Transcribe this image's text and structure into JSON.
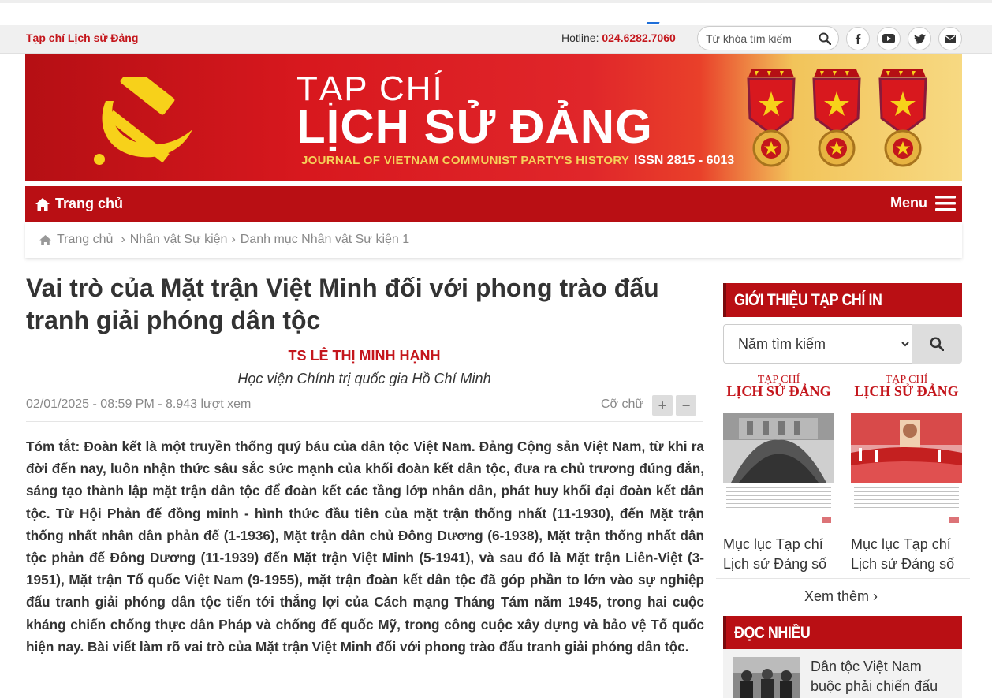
{
  "topbar": {
    "site_name": "Tạp chí Lịch sử Đảng",
    "hotline_label": "Hotline: ",
    "hotline_number": "024.6282.7060",
    "search_placeholder": "Từ khóa tìm kiếm",
    "social_icons": [
      "facebook-icon",
      "youtube-icon",
      "twitter-icon",
      "email-icon"
    ]
  },
  "banner": {
    "title_small": "TẠP CHÍ",
    "title_big": "LỊCH SỬ ĐẢNG",
    "subtitle": "JOURNAL OF VIETNAM COMMUNIST PARTY'S HISTORY",
    "issn": "ISSN 2815 - 6013"
  },
  "nav": {
    "home_label": "Trang chủ",
    "menu_label": "Menu"
  },
  "breadcrumb": {
    "items": [
      "Trang chủ",
      "Nhân vật Sự kiện",
      "Danh mục Nhân vật Sự kiện 1"
    ]
  },
  "article": {
    "title": "Vai trò của Mặt trận Việt Minh đối với phong trào đấu tranh giải phóng dân tộc",
    "author": "TS LÊ THỊ MINH HẠNH",
    "affiliation": "Học viện Chính trị quốc gia Hồ Chí Minh",
    "meta": "02/01/2025 - 08:59 PM - 8.943 lượt xem",
    "font_size_label": "Cỡ chữ",
    "font_plus": "+",
    "font_minus": "−",
    "summary": "Tóm tắt: Đoàn kết là một truyền thống quý báu của dân tộc Việt Nam. Đảng Cộng sản Việt Nam, từ khi ra đời đến nay, luôn nhận thức sâu sắc sức mạnh của khối đoàn kết dân tộc, đưa ra chủ trương đúng đắn, sáng tạo thành lập mặt trận dân tộc để đoàn kết các tầng lớp nhân dân, phát huy khối đại đoàn kết dân tộc. Từ Hội Phản đế đồng minh - hình thức đầu tiên của mặt trận thống nhất (11-1930), đến Mặt trận thống nhất nhân dân phản đế (1-1936), Mặt trận dân chủ Đông Dương (6-1938), Mặt trận thống nhất dân tộc phản đế Đông Dương (11-1939) đến Mặt trận Việt Minh (5-1941), và sau đó là Mặt trận Liên-Việt (3-1951), Mặt trận Tổ quốc Việt Nam (9-1955), mặt trận đoàn kết dân tộc đã góp phần to lớn vào sự nghiệp đấu tranh giải phóng dân tộc tiến tới thắng lợi của Cách mạng Tháng Tám năm 1945, trong hai cuộc kháng chiến chống thực dân Pháp và chống đế quốc Mỹ, trong công cuộc xây dựng và bảo vệ Tổ quốc hiện nay. Bài viết làm rõ vai trò của Mặt trận Việt Minh đối với phong trào đấu tranh giải phóng dân tộc."
  },
  "sidebar": {
    "intro_header": "GIỚI THIỆU TẠP CHÍ IN",
    "year_select": "Năm tìm kiếm",
    "magazines": [
      {
        "cover_title_small": "TẠP CHÍ",
        "cover_title_big": "LỊCH SỬ ĐẢNG",
        "caption": "Mục lục Tạp chí Lịch sử Đảng số"
      },
      {
        "cover_title_small": "TẠP CHÍ",
        "cover_title_big": "LỊCH SỬ ĐẢNG",
        "caption": "Mục lục Tạp chí Lịch sử Đảng số"
      }
    ],
    "see_more": "Xem thêm",
    "popular_header": "ĐỌC NHIỀU",
    "popular": [
      {
        "title": "Dân tộc Việt Nam buộc phải chiến đấu"
      }
    ]
  },
  "colors": {
    "brand_red": "#c4161c",
    "nav_red": "#b90f14",
    "gold": "#f5d25a"
  }
}
